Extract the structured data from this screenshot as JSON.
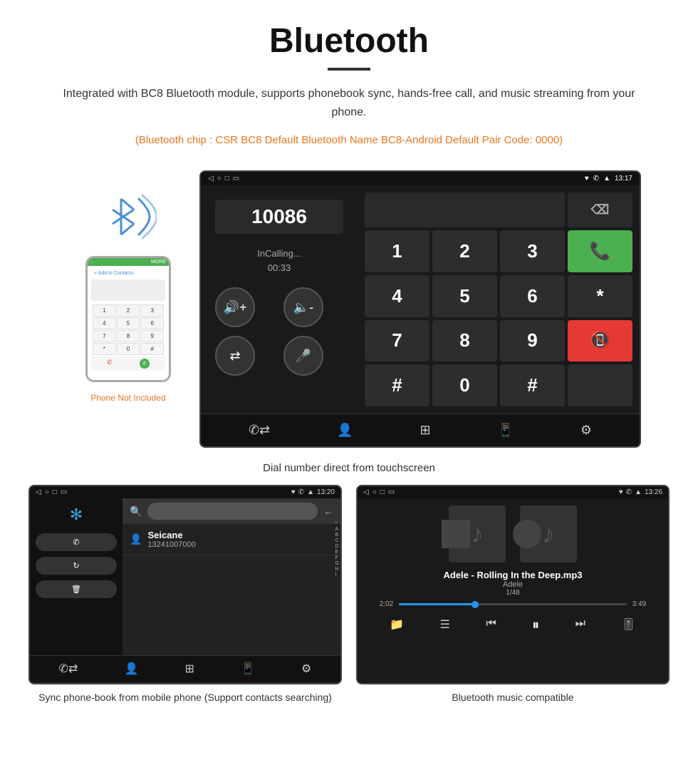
{
  "page": {
    "title": "Bluetooth",
    "description": "Integrated with BC8 Bluetooth module, supports phonebook sync, hands-free call, and music streaming from your phone.",
    "orange_note": "(Bluetooth chip : CSR BC8    Default Bluetooth Name BC8-Android    Default Pair Code: 0000)"
  },
  "phone_section": {
    "not_included": "Phone Not Included",
    "dial_caption": "Dial number direct from touchscreen"
  },
  "dial_screen": {
    "status_time": "13:17",
    "status_icons": "♥ ✆ ▲",
    "nav_icons": [
      "◁",
      "○",
      "□"
    ],
    "number": "10086",
    "in_calling": "InCalling...",
    "timer": "00:33",
    "keys": [
      "1",
      "2",
      "3",
      "*",
      "4",
      "5",
      "6",
      "0",
      "7",
      "8",
      "9",
      "#"
    ],
    "bottom_icons": [
      "✆",
      "👤",
      "⊞",
      "📱",
      "⚙"
    ]
  },
  "contact_screen": {
    "status_time": "13:20",
    "contact_name": "Seicane",
    "contact_number": "13241007000",
    "alpha_list": [
      "*",
      "A",
      "B",
      "C",
      "D",
      "E",
      "F",
      "G",
      "H",
      "I"
    ],
    "caption": "Sync phone-book from mobile phone\n(Support contacts searching)"
  },
  "music_screen": {
    "status_time": "13:26",
    "song_title": "Adele - Rolling In the Deep.mp3",
    "artist": "Adele",
    "track": "1/48",
    "time_current": "2:02",
    "time_total": "3:49",
    "progress_percent": 35,
    "caption": "Bluetooth music compatible"
  }
}
